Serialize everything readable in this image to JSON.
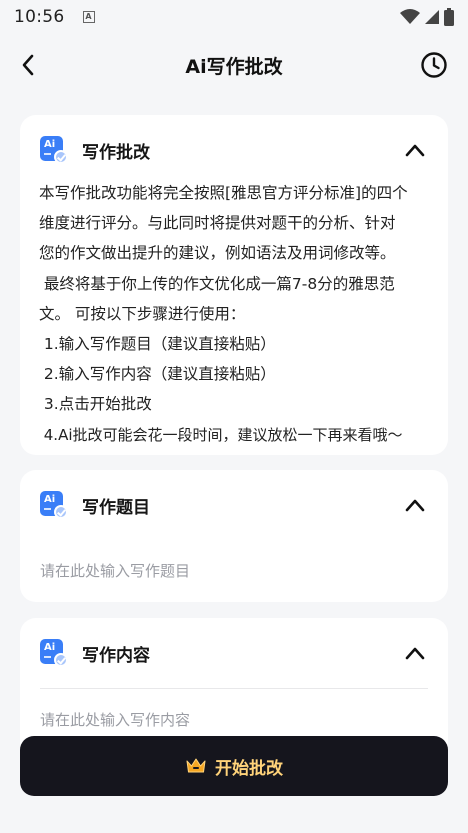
{
  "status_bar": {
    "time": "10:56",
    "a_label": "A"
  },
  "nav": {
    "title": "Ai写作批改"
  },
  "intro_card": {
    "title": "写作批改",
    "badge_label": "Ai",
    "lines": [
      "本写作批改功能将完全按照[雅思官方评分标准]的四个",
      "维度进行评分。与此同时将提供对题干的分析、针对",
      "您的作文做出提升的建议，例如语法及用词修改等。",
      " 最终将基于你上传的作文优化成一篇7-8分的雅思范",
      "文。 可按以下步骤进行使用：",
      " 1.输入写作题目（建议直接粘贴）",
      " 2.输入写作内容（建议直接粘贴）",
      " 3.点击开始批改",
      " 4.Ai批改可能会花一段时间，建议放松一下再来看哦～"
    ]
  },
  "topic_card": {
    "title": "写作题目",
    "badge_label": "Ai",
    "placeholder": "请在此处输入写作题目"
  },
  "content_card": {
    "title": "写作内容",
    "badge_label": "Ai",
    "placeholder": "请在此处输入写作内容"
  },
  "start_button": {
    "label": "开始批改"
  },
  "colors": {
    "accent": "#3a7ef7",
    "button_bg": "#15151d",
    "button_text": "#ffd37a"
  }
}
